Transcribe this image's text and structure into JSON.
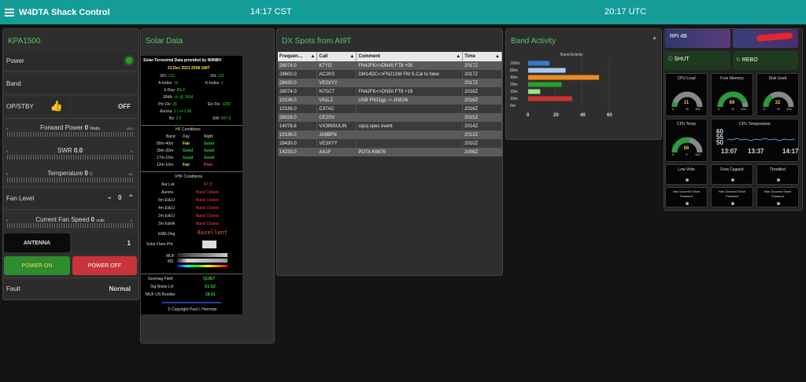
{
  "header": {
    "title": "W4DTA Shack Control",
    "local_time": "14:17 CST",
    "utc_time": "20:17 UTC"
  },
  "kpa": {
    "title": "KPA1500",
    "power_label": "Power",
    "band_label": "Band",
    "opstby_label": "OP/STBY",
    "off_label": "OFF",
    "fwd": {
      "label": "Forward Power",
      "value": "0",
      "unit": "Watts",
      "min": "0",
      "max": "1800"
    },
    "swr": {
      "label": "SWR",
      "value": "0.0",
      "min": "0",
      "max": "5"
    },
    "temp": {
      "label": "Temperature",
      "value": "0",
      "unit": "C",
      "min": "0",
      "max": "80"
    },
    "fan_level_label": "Fan Level",
    "fan_level_value": "0",
    "fan_speed": {
      "label": "Current Fan Speed",
      "value": "0",
      "unit": "units",
      "min": "0",
      "max": "5"
    },
    "antenna_label": "ANTENNA",
    "antenna_value": "1",
    "power_on": "POWER ON",
    "power_off": "POWER OFF",
    "fault_label": "Fault",
    "fault_value": "Normal",
    "colors": {
      "green_btn": "#2e8b2e",
      "red_btn": "#c8343a",
      "accent": "#5cc26a"
    }
  },
  "solar": {
    "title": "Solar Data",
    "provided_by": "Solar-Terrestrial Data provided by N0NBH",
    "date": "21 Dec 2021 2008 GMT",
    "sfi_label": "SFI:",
    "sfi": "132",
    "sn_label": "SN:",
    "sn": "115",
    "aindex_label": "A-Index:",
    "aindex": "16",
    "kindex_label": "K-Index:",
    "kindex": "2",
    "xray_label": "X-Ray:",
    "xray": "B6.8",
    "h304_label": "304A:",
    "h304": "ch @ SEM",
    "ptnflx_label": "Ptn Flx:",
    "ptnflx": "36",
    "elcflx_label": "Elc Flx:",
    "elcflx": "1260",
    "aurora_label": "Aurora:",
    "aurora": "1 / n=1.99",
    "bz_label": "Bz:",
    "bz": "2.6",
    "sw_label": "SW:",
    "sw": "567.0",
    "hf_title": "HF Conditions",
    "hf_head": [
      "Band",
      "Day",
      "Night"
    ],
    "hf_rows": [
      {
        "band": "80m-40m",
        "day": "Fair",
        "night": "Good"
      },
      {
        "band": "30m-20m",
        "day": "Good",
        "night": "Good"
      },
      {
        "band": "17m-15m",
        "day": "Good",
        "night": "Good"
      },
      {
        "band": "12m-10m",
        "day": "Fair",
        "night": "Poor"
      }
    ],
    "vhf_title": "VHF Conditions",
    "vhf_rows": [
      {
        "name": "Aur Lat",
        "value": "67.5°"
      },
      {
        "name": "Aurora",
        "value": "Band Closed"
      },
      {
        "name": "6m EsEU",
        "value": "Band Closed"
      },
      {
        "name": "4m EsEU",
        "value": "Band Closed"
      },
      {
        "name": "2m EsEU",
        "value": "Band Closed"
      },
      {
        "name": "2m EsNA",
        "value": "Band Closed"
      }
    ],
    "eme_label": "EME Deg",
    "eme_value": "Excellent",
    "flare_label": "Solar Flare Prb",
    "muf_label": "MUF",
    "ms_label": "MS",
    "geomag_label": "Geomag Field",
    "geomag": "QUIET",
    "signoise_label": "Sig Noise Lvl",
    "signoise": "S1-S2",
    "muf_boulder_label": "MUF US Boulder",
    "muf_boulder": "28.91",
    "copyright": "© Copyright Paul L Herrman"
  },
  "dx": {
    "title": "DX Spots from AI9T",
    "columns": [
      "Frequen…",
      "Call",
      "Comment",
      "Time"
    ],
    "rows": [
      [
        "28074.0",
        "K7YO",
        "FN42FK<>DN45 FT8 +05",
        "2017Z"
      ],
      [
        "29600.0",
        "AC2KS",
        "DM14DC<>FN21XM FM S.Cal to New",
        "2017Z"
      ],
      [
        "28430.0",
        "VE3XYY",
        "",
        "2017Z"
      ],
      [
        "28074.0",
        "N7SCT",
        "FN42FK<>DN50 FT8 +19",
        "2016Z"
      ],
      [
        "10136.0",
        "V51LZ",
        "USB FN31gp -> JG81fk",
        "2016Z"
      ],
      [
        "10136.0",
        "C37AC",
        "",
        "2016Z"
      ],
      [
        "28028.0",
        "CE2SV",
        "",
        "2015Z"
      ],
      [
        "14076.8",
        "VX3INSULIN",
        "cqcq spec event",
        "2014Z"
      ],
      [
        "10136.0",
        "JA9BFN",
        "",
        "2012Z"
      ],
      [
        "28430.0",
        "VE3XYY",
        "",
        "2010Z"
      ],
      [
        "14233.0",
        "AA1F",
        "POTA K6876",
        "2008Z"
      ]
    ]
  },
  "band_activity": {
    "title": "Band Activity"
  },
  "chart_data": {
    "type": "bar",
    "title": "Band Activity",
    "categories": [
      "160m",
      "80m",
      "40m",
      "20m",
      "15m",
      "10m",
      "6m"
    ],
    "values": [
      16,
      28,
      53,
      25,
      9,
      33,
      0
    ],
    "colors": [
      "#3a78c8",
      "#a8c8f0",
      "#f08a20",
      "#2ca02c",
      "#98e08a",
      "#d03030",
      "#888888"
    ],
    "xticks": [
      "0",
      "20",
      "40",
      "60"
    ],
    "xlim": [
      0,
      60
    ],
    "grid": true
  },
  "status": {
    "rpi_label": "RPi 4B",
    "shutdown_label": "SHUT",
    "reboot_label": "REBO",
    "cpu_load": {
      "label": "CPU Load",
      "value": "11",
      "unit": "%",
      "min": "0",
      "max": "100"
    },
    "free_mem": {
      "label": "Free Memory",
      "value": "89",
      "unit": "%",
      "min": "0",
      "max": "100"
    },
    "disk": {
      "label": "Disk Used",
      "value": "32",
      "unit": "%",
      "min": "0",
      "max": "100"
    },
    "cpu_temp": {
      "label": "CPU Temp",
      "value": "56",
      "unit": "C",
      "min": "0",
      "max": "100"
    },
    "temp_chart": {
      "label": "CPU Temperature",
      "y_hi": "60",
      "y_mid": "55",
      "y_lo": "50",
      "times": [
        "13:07",
        "13:37",
        "14:17"
      ]
    },
    "low_volts": "Low Volts",
    "freq_capped": "Freq Capped",
    "throttled": "Throttled",
    "occurred1": "Has Occured Since Powered",
    "occurred2": "Has Occured Since Powered",
    "occurred3": "Has Occured Since Powered"
  }
}
